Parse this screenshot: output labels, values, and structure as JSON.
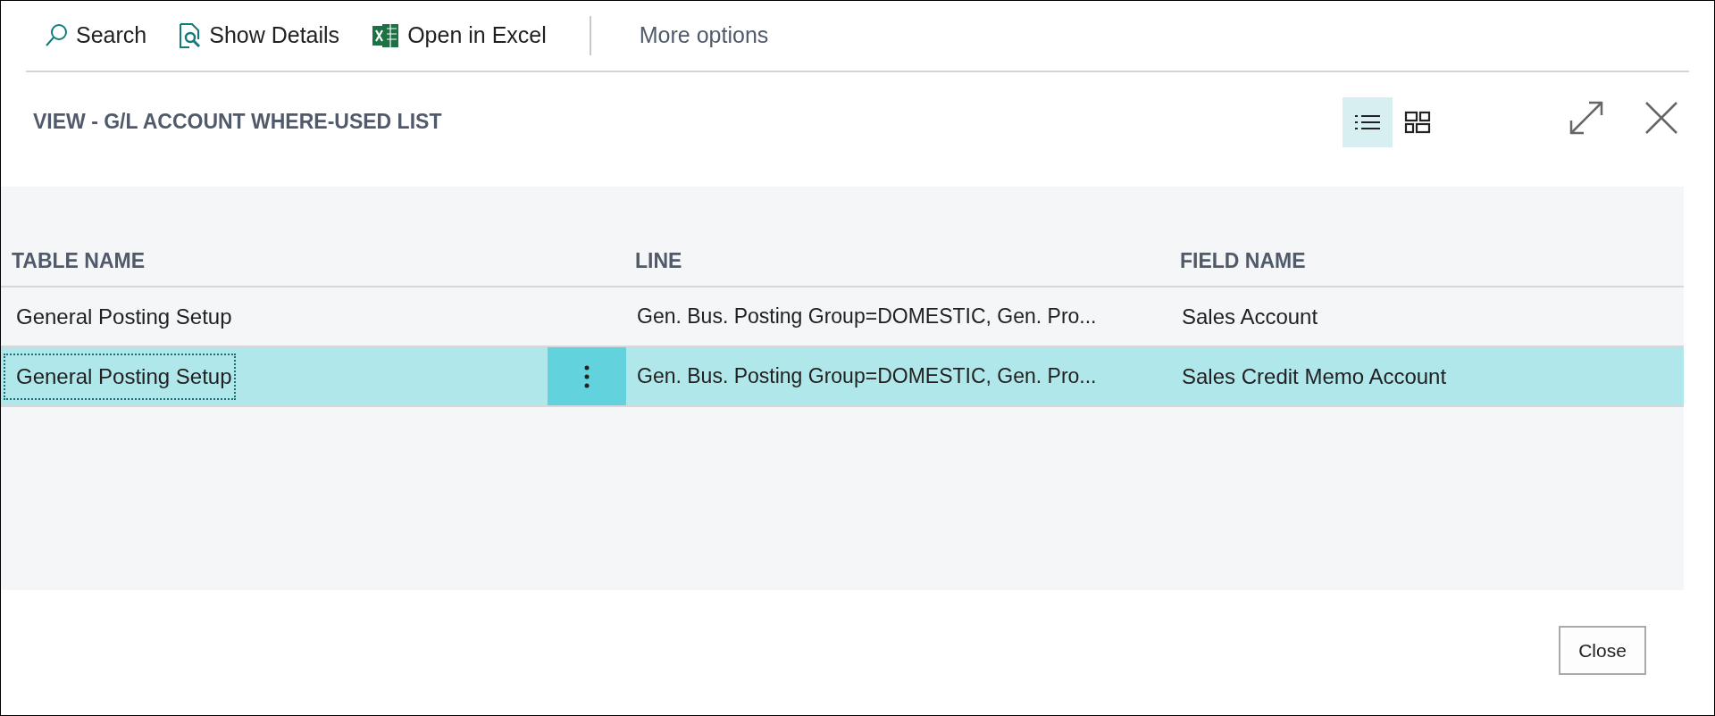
{
  "toolbar": {
    "actions": [
      {
        "kind": "search",
        "label": "Search"
      },
      {
        "kind": "details",
        "label": "Show Details"
      },
      {
        "kind": "excel",
        "label": "Open in Excel"
      }
    ],
    "more": "More options"
  },
  "title": "VIEW - G/L ACCOUNT WHERE-USED LIST",
  "view_toggle": [
    {
      "kind": "list",
      "selected": true
    },
    {
      "kind": "tiles",
      "selected": false
    }
  ],
  "table": {
    "columns": [
      "TABLE NAME",
      "LINE",
      "FIELD NAME"
    ],
    "rows": [
      {
        "table_name": "General Posting Setup",
        "line": "Gen. Bus. Posting Group=DOMESTIC, Gen. Pro...",
        "field_name": "Sales Account",
        "selected": false
      },
      {
        "table_name": "General Posting Setup",
        "line": "Gen. Bus. Posting Group=DOMESTIC, Gen. Pro...",
        "field_name": "Sales Credit Memo Account",
        "selected": true
      }
    ]
  },
  "close_button": "Close"
}
